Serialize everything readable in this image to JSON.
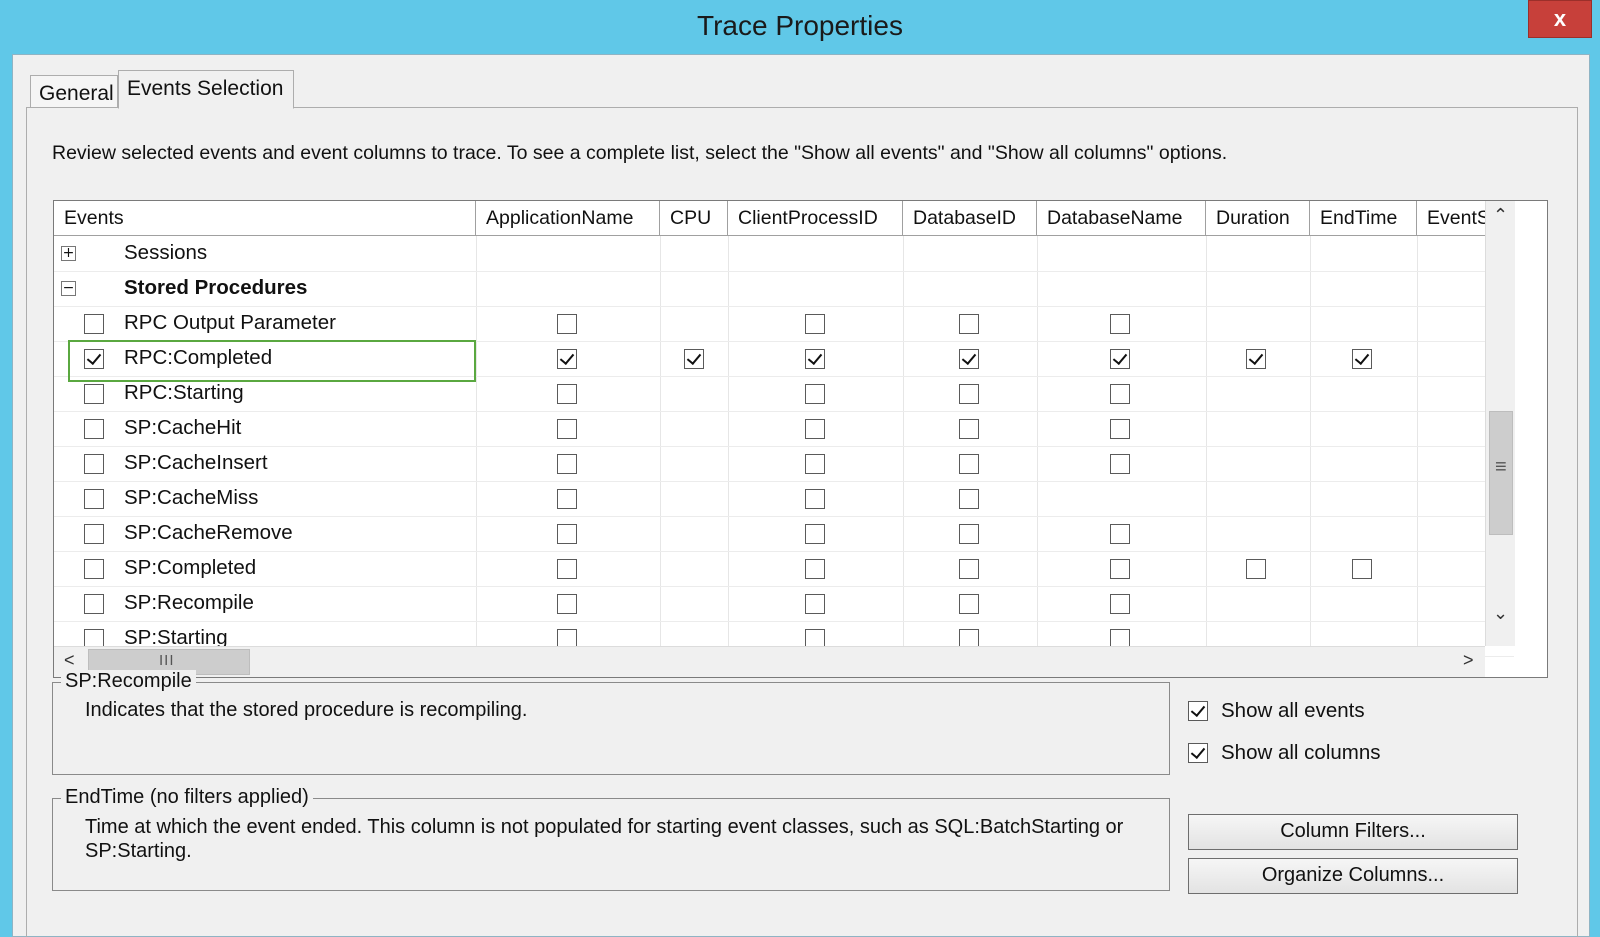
{
  "window": {
    "title": "Trace Properties",
    "close_glyph": "x"
  },
  "tabs": [
    {
      "label": "General",
      "selected": false
    },
    {
      "label": "Events Selection",
      "selected": true
    }
  ],
  "intro_text": "Review selected events and event columns to trace. To see a complete list, select the \"Show all events\" and \"Show all columns\" options.",
  "grid": {
    "columns": [
      "Events",
      "ApplicationName",
      "CPU",
      "ClientProcessID",
      "DatabaseID",
      "DatabaseName",
      "Duration",
      "EndTime",
      "EventS"
    ],
    "categories": [
      {
        "label": "Sessions",
        "expander": "+"
      },
      {
        "label": "Stored Procedures",
        "expander": "−"
      }
    ],
    "events": [
      {
        "label": "RPC Output Parameter",
        "selected": false,
        "cells": [
          false,
          null,
          false,
          false,
          false,
          null,
          null
        ]
      },
      {
        "label": "RPC:Completed",
        "selected": true,
        "cells": [
          true,
          true,
          true,
          true,
          true,
          true,
          true
        ]
      },
      {
        "label": "RPC:Starting",
        "selected": false,
        "cells": [
          false,
          null,
          false,
          false,
          false,
          null,
          null
        ]
      },
      {
        "label": "SP:CacheHit",
        "selected": false,
        "cells": [
          false,
          null,
          false,
          false,
          false,
          null,
          null
        ]
      },
      {
        "label": "SP:CacheInsert",
        "selected": false,
        "cells": [
          false,
          null,
          false,
          false,
          false,
          null,
          null
        ]
      },
      {
        "label": "SP:CacheMiss",
        "selected": false,
        "cells": [
          false,
          null,
          false,
          false,
          null,
          null,
          null
        ]
      },
      {
        "label": "SP:CacheRemove",
        "selected": false,
        "cells": [
          false,
          null,
          false,
          false,
          false,
          null,
          null
        ]
      },
      {
        "label": "SP:Completed",
        "selected": false,
        "cells": [
          false,
          null,
          false,
          false,
          false,
          false,
          false
        ]
      },
      {
        "label": "SP:Recompile",
        "selected": false,
        "cells": [
          false,
          null,
          false,
          false,
          false,
          null,
          null
        ]
      },
      {
        "label": "SP:Starting",
        "selected": false,
        "cells": [
          false,
          null,
          false,
          false,
          false,
          null,
          null
        ]
      }
    ],
    "highlighted_event": "RPC:Completed",
    "hscroll_glyph": "III",
    "vscroll_glyph": "≡"
  },
  "event_description": {
    "title": "SP:Recompile",
    "text": "Indicates that the stored procedure is recompiling."
  },
  "column_description": {
    "title": "EndTime (no filters applied)",
    "text": "Time at which the event ended. This column is not populated for starting event classes, such as SQL:BatchStarting or SP:Starting."
  },
  "options": {
    "show_all_events": {
      "label": "Show all events",
      "checked": true
    },
    "show_all_columns": {
      "label": "Show all columns",
      "checked": true
    }
  },
  "buttons": {
    "column_filters": "Column Filters...",
    "organize_columns": "Organize Columns..."
  }
}
